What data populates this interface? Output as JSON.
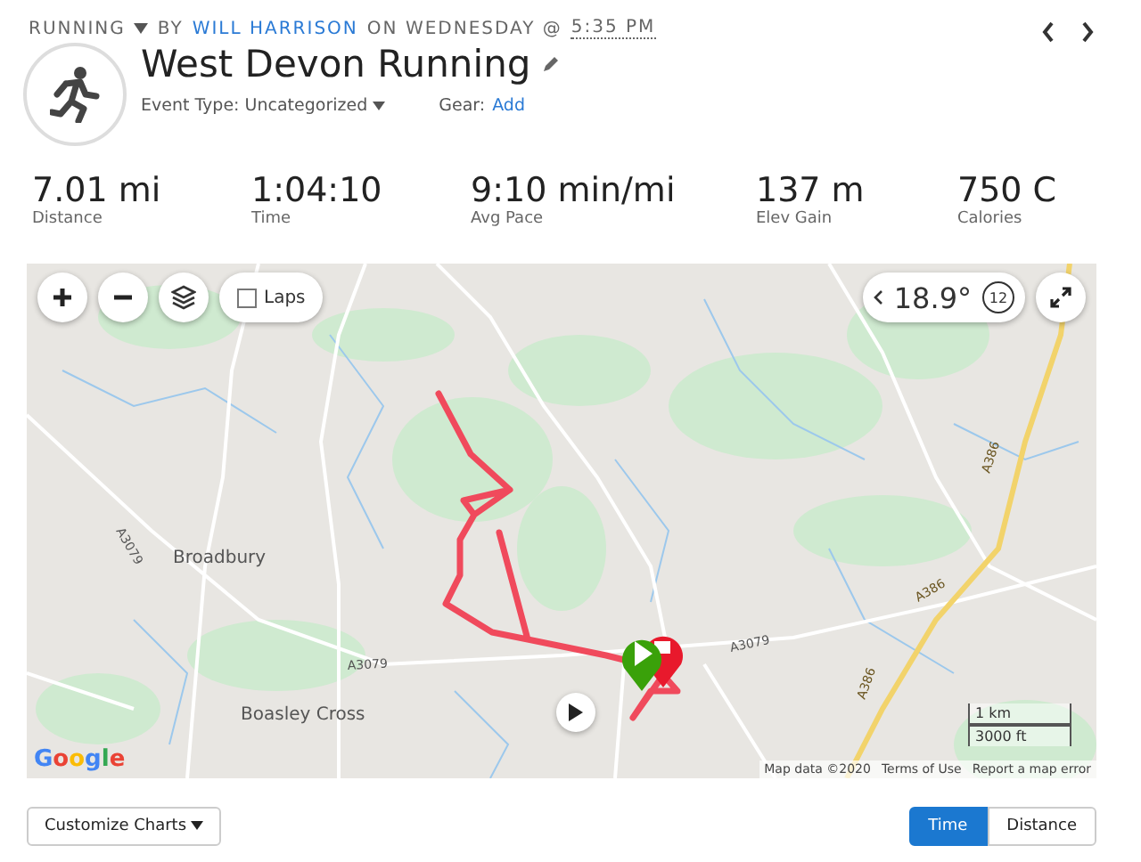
{
  "activity": {
    "type": "RUNNING",
    "by": "BY",
    "author": "WILL HARRISON",
    "on": "ON WEDNESDAY @",
    "time": "5:35 PM",
    "title": "West Devon Running",
    "event_type_label": "Event Type:",
    "event_type": "Uncategorized",
    "gear_label": "Gear:",
    "gear_action": "Add"
  },
  "stats": [
    {
      "value": "7.01 mi",
      "label": "Distance"
    },
    {
      "value": "1:04:10",
      "label": "Time"
    },
    {
      "value": "9:10 min/mi",
      "label": "Avg Pace"
    },
    {
      "value": "137 m",
      "label": "Elev Gain"
    },
    {
      "value": "750 C",
      "label": "Calories"
    }
  ],
  "map": {
    "laps": {
      "label": "Laps",
      "checked": false
    },
    "temperature": "18.9°",
    "wind": "12",
    "labels": [
      {
        "text": "Broadbury",
        "kind": "place"
      },
      {
        "text": "Boasley Cross",
        "kind": "place"
      },
      {
        "text": "A3079",
        "kind": "road"
      },
      {
        "text": "A3079",
        "kind": "road"
      },
      {
        "text": "A3079",
        "kind": "road"
      },
      {
        "text": "A386",
        "kind": "highway"
      },
      {
        "text": "A386",
        "kind": "highway"
      },
      {
        "text": "A386",
        "kind": "highway"
      }
    ],
    "scale": [
      "1 km",
      "3000 ft"
    ],
    "logo": "Google",
    "attribution": [
      "Map data ©2020",
      "Terms of Use",
      "Report a map error"
    ]
  },
  "chart_controls": {
    "customize": "Customize Charts",
    "axis": [
      {
        "label": "Time",
        "selected": true
      },
      {
        "label": "Distance",
        "selected": false
      }
    ]
  }
}
